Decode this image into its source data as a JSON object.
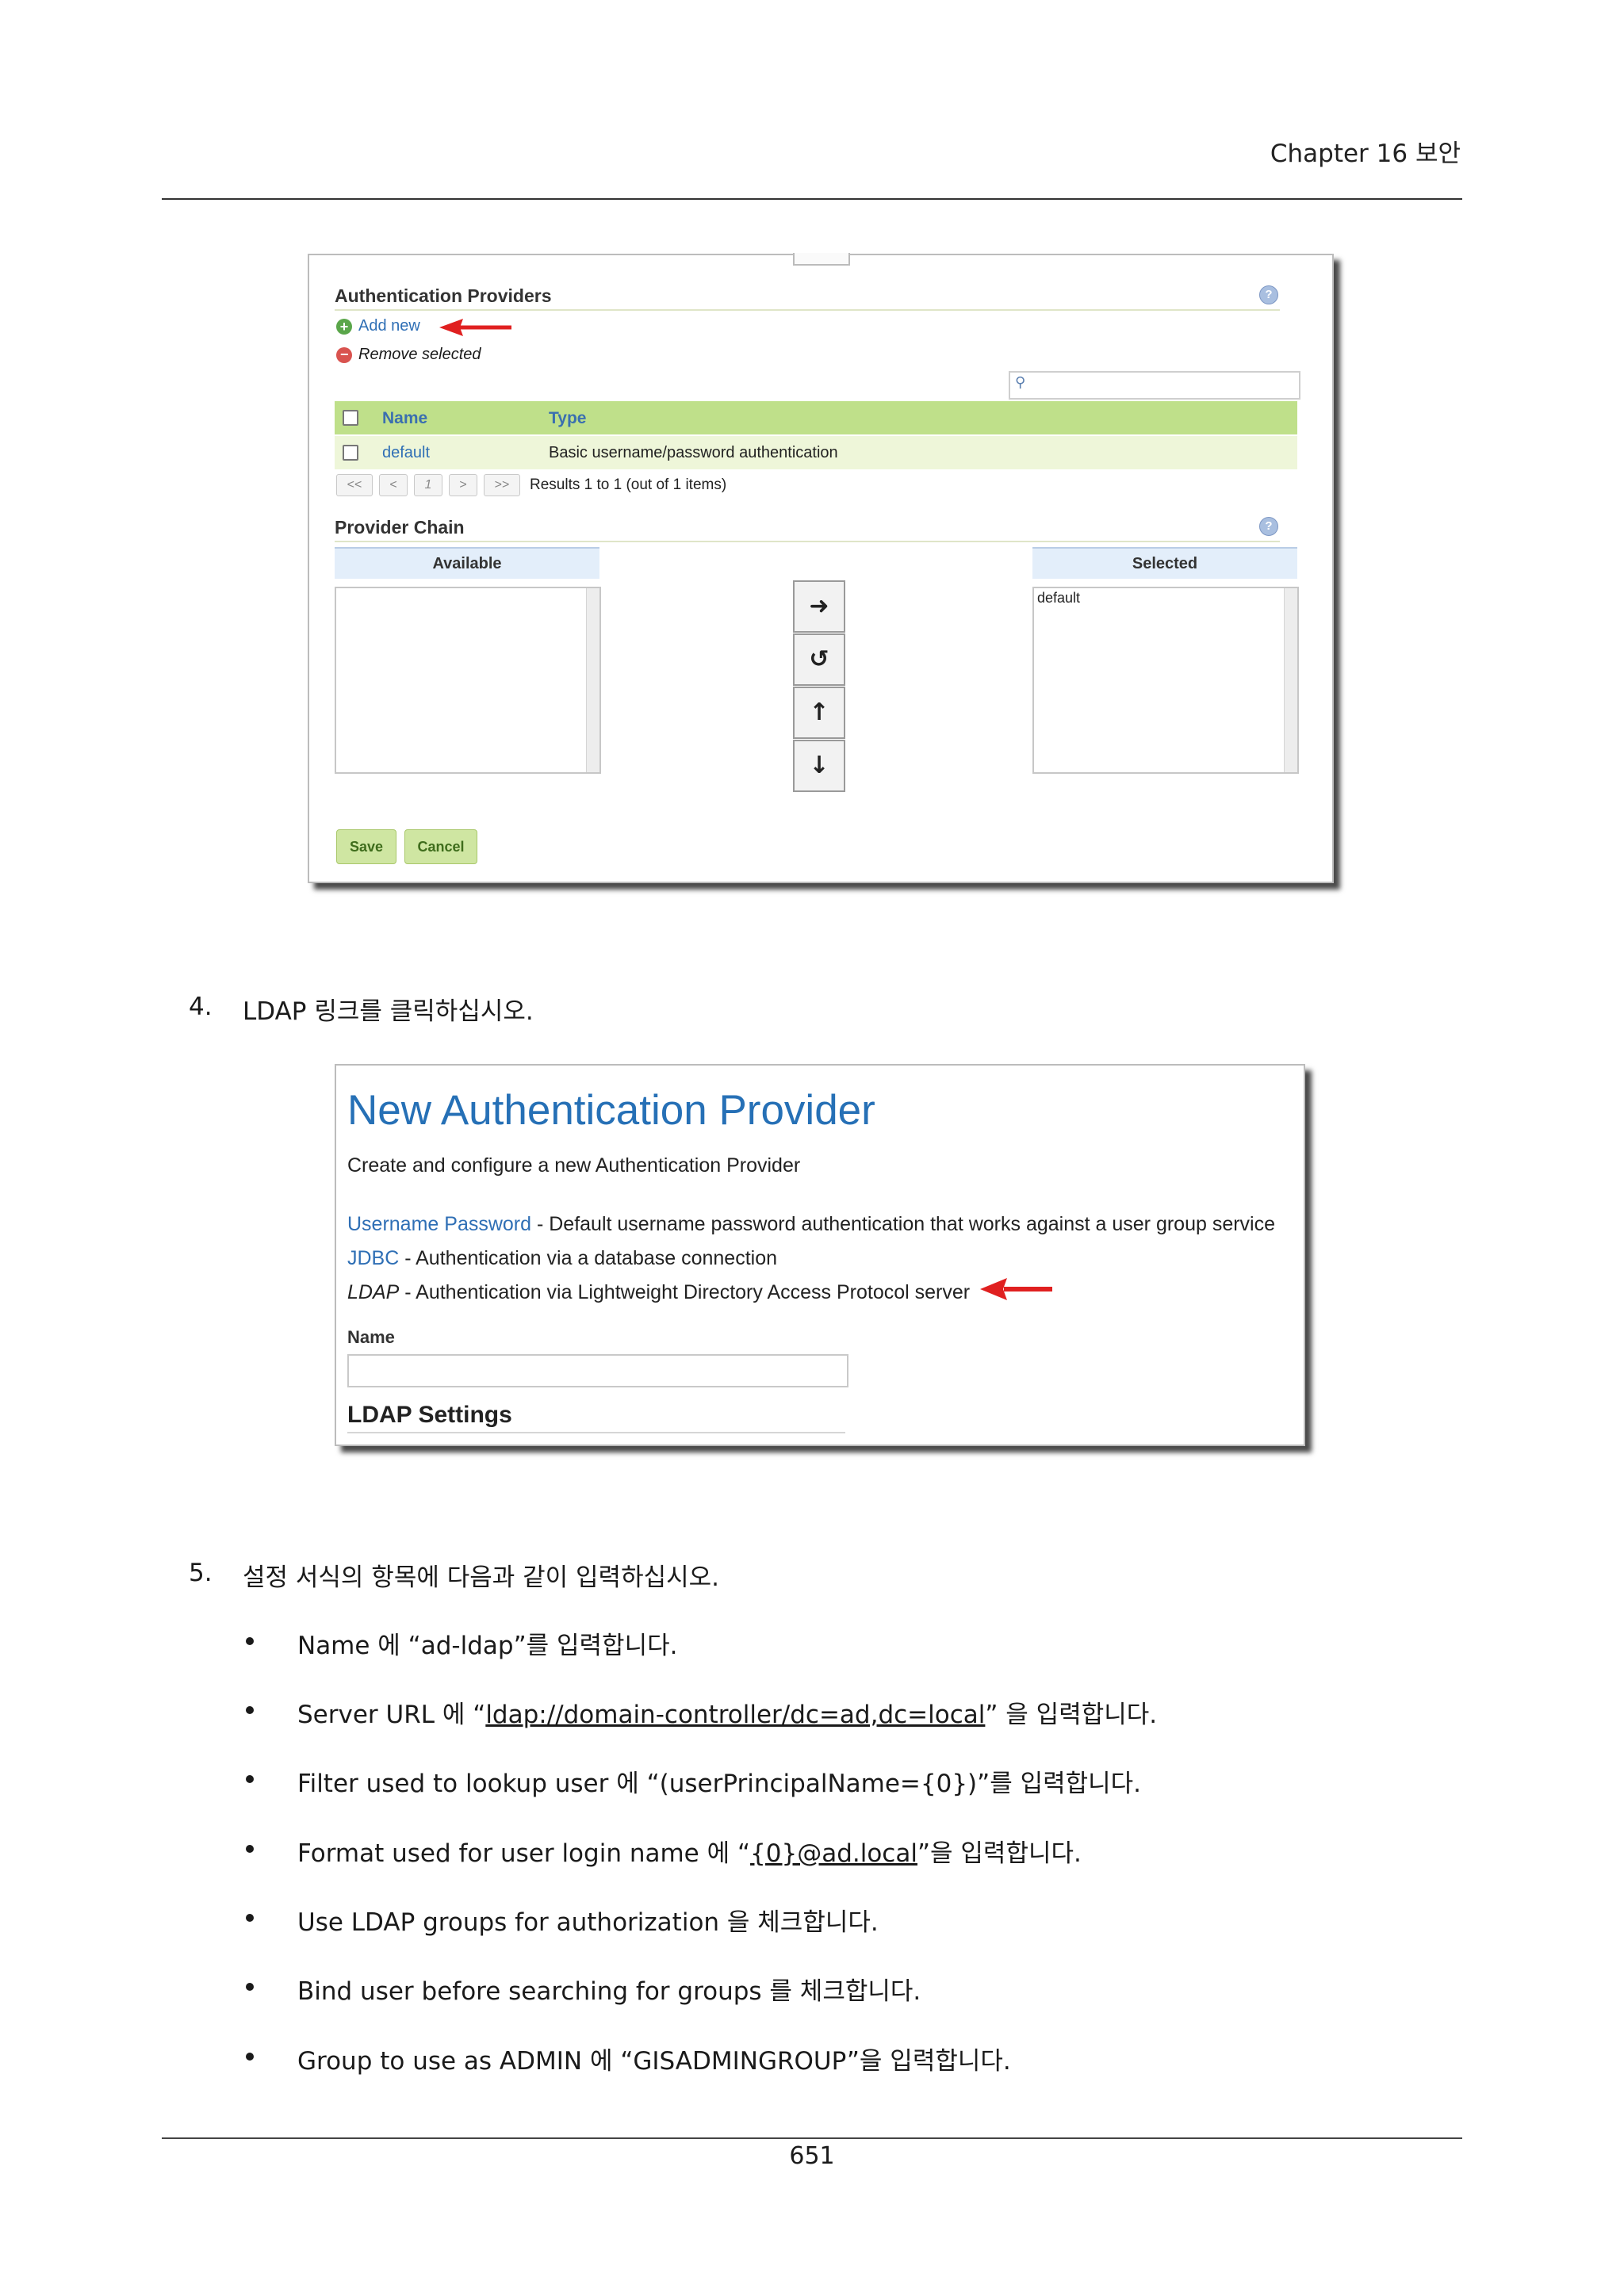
{
  "header": {
    "chapter": "Chapter 16 보안"
  },
  "screenshot1": {
    "auth_providers": {
      "title": "Authentication Providers",
      "add_new": "Add new",
      "remove_selected": "Remove selected",
      "columns": [
        "Name",
        "Type"
      ],
      "rows": [
        {
          "name": "default",
          "type": "Basic username/password authentication"
        }
      ],
      "pager": {
        "buttons": [
          "<<",
          "<",
          "1",
          ">",
          ">>"
        ],
        "results": "Results 1 to 1 (out of 1 items)"
      }
    },
    "provider_chain": {
      "title": "Provider Chain",
      "available_label": "Available",
      "selected_label": "Selected",
      "selected_items": [
        "default"
      ]
    },
    "buttons": {
      "save": "Save",
      "cancel": "Cancel"
    },
    "accent_color": "#bfe08a"
  },
  "step4": {
    "number": "4.",
    "text": "LDAP 링크를 클릭하십시오."
  },
  "screenshot2": {
    "title": "New Authentication Provider",
    "subtitle": "Create and configure a new Authentication Provider",
    "options": [
      {
        "link": "Username Password",
        "desc": " - Default username password authentication that works against a user group service"
      },
      {
        "link": "JDBC",
        "desc": " - Authentication via a database connection"
      },
      {
        "link": "LDAP",
        "desc": " - Authentication via Lightweight Directory Access Protocol server"
      }
    ],
    "name_label": "Name",
    "ldap_settings": "LDAP Settings",
    "title_color": "#2670b6"
  },
  "step5": {
    "number": "5.",
    "text": "설정 서식의 항목에 다음과 같이 입력하십시오."
  },
  "bullets": [
    {
      "pre": "Name 에 “ad-ldap”를 입력합니다.",
      "u": "",
      "post": ""
    },
    {
      "pre": "Server URL 에 “",
      "u": "ldap://domain-controller/dc=ad,dc=local",
      "post": "” 을 입력합니다."
    },
    {
      "pre": "Filter used to lookup user 에 “(userPrincipalName={0})”를 입력합니다.",
      "u": "",
      "post": ""
    },
    {
      "pre": "Format used for user login name 에 “",
      "u": "{0}@ad.local",
      "post": "”을 입력합니다."
    },
    {
      "pre": "Use LDAP groups for authorization 을 체크합니다.",
      "u": "",
      "post": ""
    },
    {
      "pre": "Bind user before searching for groups 를 체크합니다.",
      "u": "",
      "post": ""
    },
    {
      "pre": "Group to use as ADMIN 에 “GISADMINGROUP”을 입력합니다.",
      "u": "",
      "post": ""
    }
  ],
  "footer": {
    "page_number": "651"
  }
}
